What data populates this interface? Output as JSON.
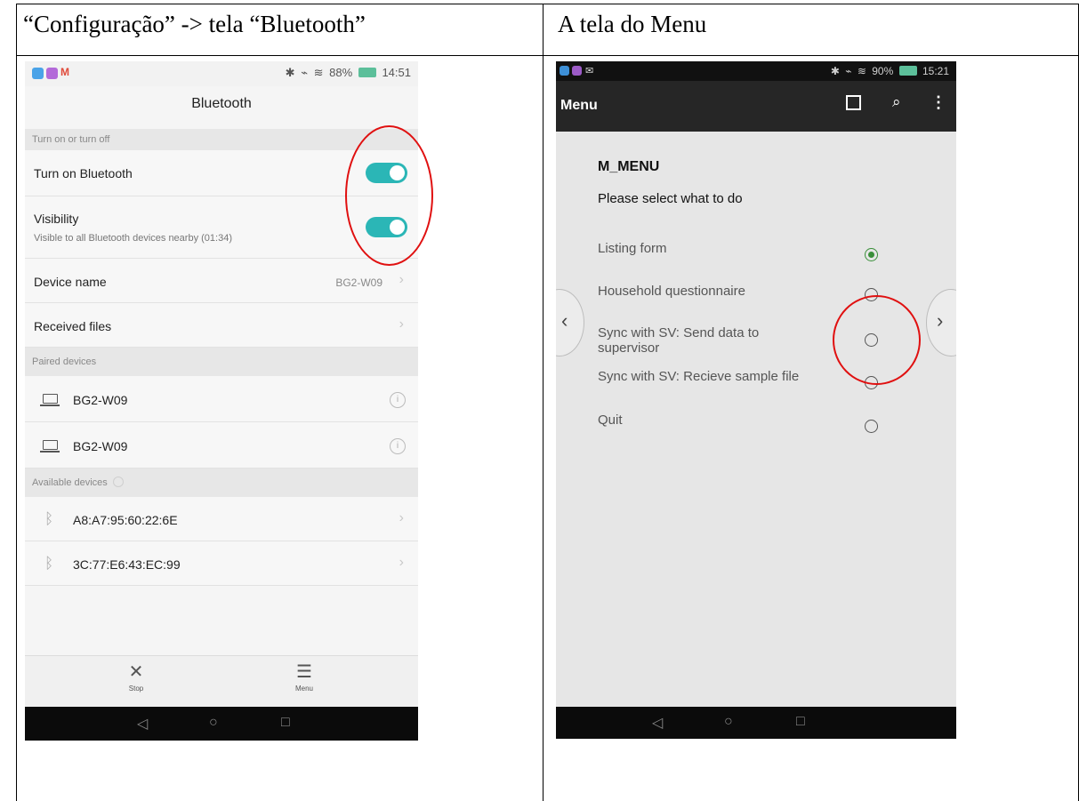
{
  "document": {
    "left_header": "“Configuração” -> tela “Bluetooth”",
    "right_header": "A tela do Menu"
  },
  "left_phone": {
    "status": {
      "battery": "88%",
      "time": "14:51"
    },
    "title": "Bluetooth",
    "section_toggle": "Turn on or turn off",
    "turn_on_label": "Turn on Bluetooth",
    "turn_on_state": true,
    "visibility_label": "Visibility",
    "visibility_sub": "Visible to all Bluetooth devices nearby (01:34)",
    "visibility_state": true,
    "device_name_label": "Device name",
    "device_name_value": "BG2-W09",
    "received_files_label": "Received files",
    "section_paired": "Paired devices",
    "paired": [
      "BG2-W09",
      "BG2-W09"
    ],
    "section_available": "Available devices",
    "available": [
      "A8:A7:95:60:22:6E",
      "3C:77:E6:43:EC:99"
    ],
    "bottom": {
      "stop": "Stop",
      "menu": "Menu"
    },
    "colors": {
      "toggle": "#2bb6b6",
      "annotation": "#e01010"
    }
  },
  "right_phone": {
    "status": {
      "battery": "90%",
      "time": "15:21"
    },
    "appbar_title": "Menu",
    "heading": "M_MENU",
    "prompt": "Please select what to do",
    "options": [
      {
        "label": "Listing form",
        "selected": true
      },
      {
        "label": "Household questionnaire",
        "selected": false
      },
      {
        "label": "Sync with SV: Send data to supervisor",
        "selected": false
      },
      {
        "label": "Sync with SV: Recieve sample file",
        "selected": false
      },
      {
        "label": "Quit",
        "selected": false
      }
    ],
    "colors": {
      "radio_selected": "#3a8f3a",
      "appbar": "#262626"
    }
  }
}
